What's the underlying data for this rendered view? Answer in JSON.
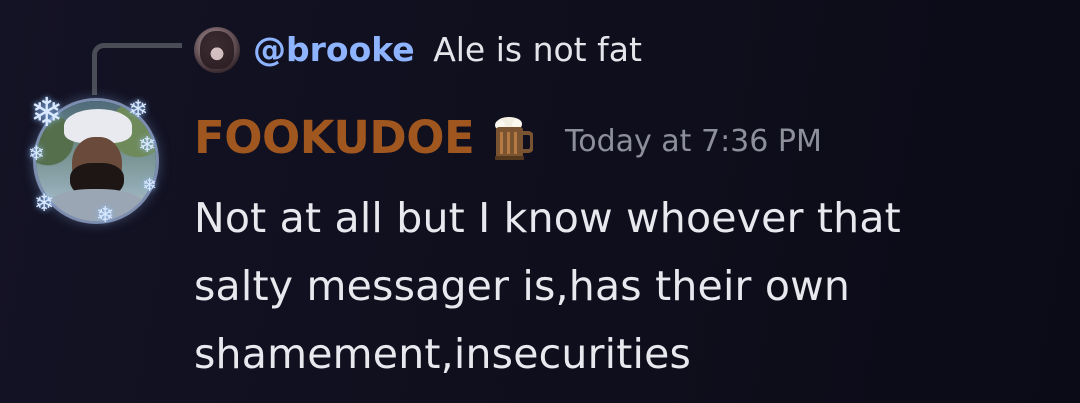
{
  "reply": {
    "mention": "@brooke",
    "text": "Ale is not fat"
  },
  "message": {
    "author": "FOOKUDOE",
    "author_color": "#a0561f",
    "badge_icon": "beer-mug-icon",
    "timestamp": "Today at 7:36 PM",
    "lines": [
      "Not at all but I know whoever that",
      "salty messager is,has their own",
      "shamement,insecurities"
    ]
  }
}
